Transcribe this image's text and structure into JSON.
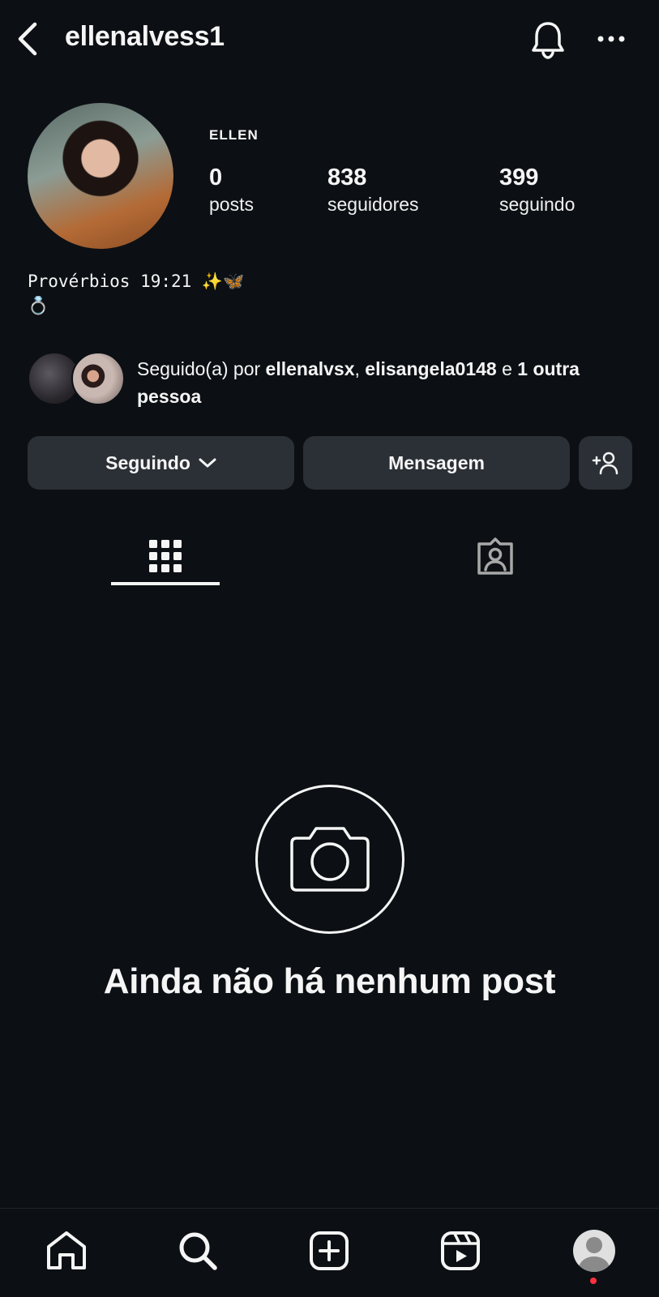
{
  "header": {
    "username": "ellenalvess1"
  },
  "profile": {
    "full_name": "ELLEN",
    "stats": {
      "posts_count": "0",
      "posts_label": "posts",
      "followers_count": "838",
      "followers_label": "seguidores",
      "following_count": "399",
      "following_label": "seguindo"
    },
    "bio_line1": "Provérbios 19:21 ✨🦋",
    "bio_line2": "💍"
  },
  "mutual": {
    "prefix": "Seguido(a) por ",
    "user1": "ellenalvsx",
    "separator": ", ",
    "user2": "elisangela0148",
    "conj": " e ",
    "others": "1 outra pessoa"
  },
  "actions": {
    "following_label": "Seguindo",
    "message_label": "Mensagem"
  },
  "empty_state": {
    "text": "Ainda não há nenhum post"
  },
  "colors": {
    "background": "#0c1014",
    "button": "#2b3036",
    "text": "#f5f5f5",
    "notification_dot": "#ff3040"
  },
  "icons": {
    "back": "chevron-left-icon",
    "bell": "bell-icon",
    "more": "more-horizontal-icon",
    "grid": "grid-icon",
    "tagged": "tagged-person-icon",
    "camera": "camera-icon",
    "home": "home-icon",
    "search": "search-icon",
    "create": "plus-square-icon",
    "reels": "reels-icon"
  }
}
